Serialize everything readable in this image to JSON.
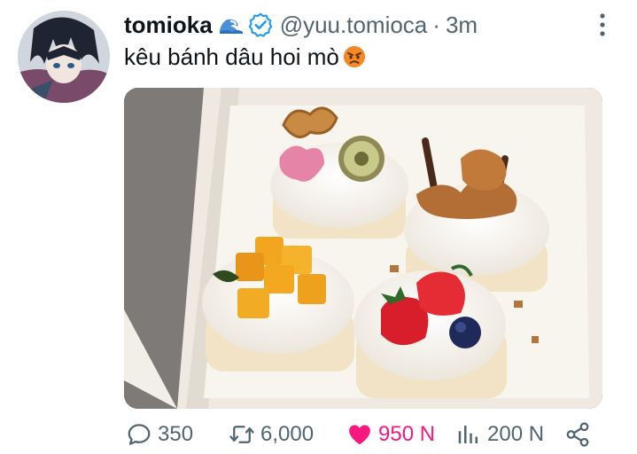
{
  "tweet": {
    "display_name": "tomioka",
    "name_emoji": "🌊",
    "handle": "@yuu.tomioca",
    "separator": "·",
    "timestamp": "3m",
    "text": "kêu bánh dâu hoi mò",
    "text_emoji": "😠",
    "verified": true,
    "liked": true
  },
  "actions": {
    "replies": "350",
    "retweets": "6,000",
    "likes": "950 N",
    "views": "200 N"
  },
  "colors": {
    "accent": "#1d9bf0",
    "like": "#f91880",
    "secondary_text": "#536471",
    "primary_text": "#0f1419"
  },
  "icons": [
    "wave-emoji",
    "verified-badge-icon",
    "more-icon",
    "reply-icon",
    "retweet-icon",
    "heart-icon",
    "views-icon",
    "share-icon",
    "angry-face-emoji"
  ]
}
